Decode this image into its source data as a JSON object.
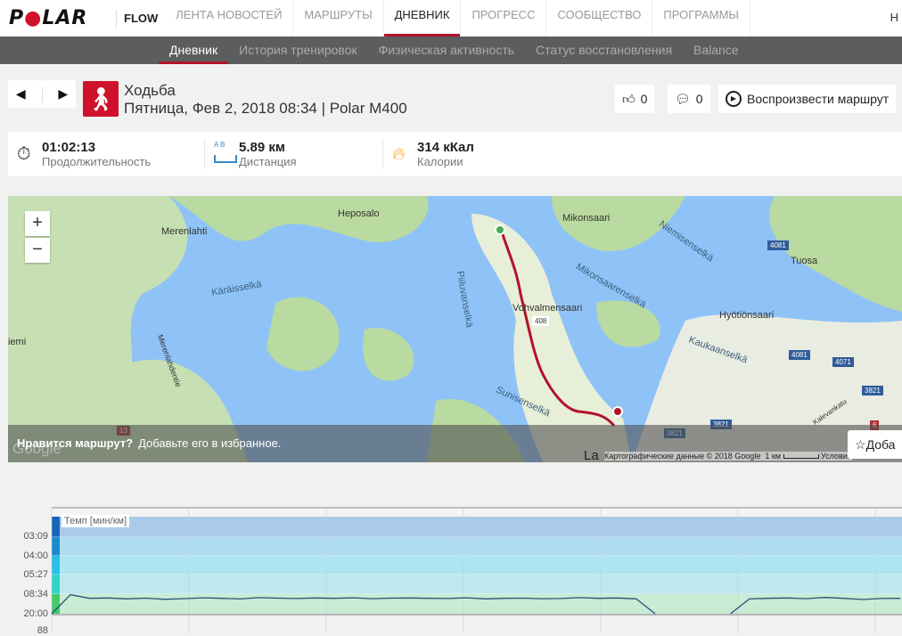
{
  "topnav": {
    "brand": "POLAR",
    "product": "FLOW",
    "items": [
      "ЛЕНТА НОВОСТЕЙ",
      "МАРШРУТЫ",
      "ДНЕВНИК",
      "ПРОГРЕСС",
      "СООБЩЕСТВО",
      "ПРОГРАММЫ"
    ],
    "active": "ДНЕВНИК",
    "right": "Н"
  },
  "subnav": {
    "items": [
      "Дневник",
      "История тренировок",
      "Физическая активность",
      "Статус восстановления",
      "Balance"
    ],
    "active": "Дневник"
  },
  "activity": {
    "sport": "Ходьба",
    "subtitle": "Пятница, Фев 2, 2018 08:34 | Polar M400",
    "likes": "0",
    "comments": "0",
    "replay_label": "Воспроизвести маршрут"
  },
  "stats": [
    {
      "value": "01:02:13",
      "label": "Продолжительность",
      "icon": "stopwatch-icon"
    },
    {
      "value": "5.89 км",
      "label": "Дистанция",
      "icon": "distance-icon",
      "ab": "A  B"
    },
    {
      "value": "314 кКал",
      "label": "Калории",
      "icon": "flame-icon"
    }
  ],
  "map": {
    "labels": [
      "Heposalo",
      "Merenlahti",
      "Mikonsaari",
      "Niemisenselkä",
      "Tuosa",
      "Käräisselkä",
      "Piiluvanselkä",
      "Mikonsaarenselkä",
      "Vohvalmensaari",
      "Hyötiönsaari",
      "Kaukaanselkä",
      "Sunisenselkä",
      "Merenlahdentie",
      "iemi",
      "Kalevankatu",
      "La"
    ],
    "roads": [
      "408",
      "4081",
      "4081",
      "4071",
      "3821",
      "3821",
      "3821",
      "13",
      "6"
    ],
    "attribution": "Картографические данные © 2018 Google",
    "scale": "1 км",
    "terms": "Условия",
    "google": "Google",
    "overlay_bold": "Нравится маршрут?",
    "overlay_text": "Добавьте его в избранное.",
    "fav_label": "Доба"
  },
  "chart_data": {
    "type": "line",
    "title": "Темп [мин/км]",
    "yticks": [
      "03:09",
      "04:00",
      "05:27",
      "08:34",
      "20:00"
    ],
    "ytick_minutes": [
      3.15,
      4.0,
      5.45,
      8.57,
      20.0
    ],
    "next_axis_tick": "88",
    "series": [
      {
        "name": "Темп",
        "values": [
          20,
          8.9,
          11,
          10.8,
          11.3,
          10.9,
          11.6,
          11.2,
          10.7,
          11.0,
          11.4,
          10.6,
          10.9,
          11.1,
          10.8,
          11.0,
          10.7,
          11.2,
          10.9,
          10.8,
          11.0,
          11.1,
          10.7,
          11.3,
          11.0,
          10.9,
          11.2,
          11.1,
          10.6,
          11.0,
          10.8,
          11.3,
          20,
          null,
          null,
          null,
          20,
          11.4,
          11.0,
          10.8,
          11.2,
          10.5,
          11.0,
          11.7,
          11.1,
          11.0
        ]
      }
    ],
    "grid": true,
    "zones_colors": [
      "#a9cbe9",
      "#b0dcf2",
      "#ade6f2",
      "#bde8ee",
      "#c8ecd4"
    ]
  }
}
